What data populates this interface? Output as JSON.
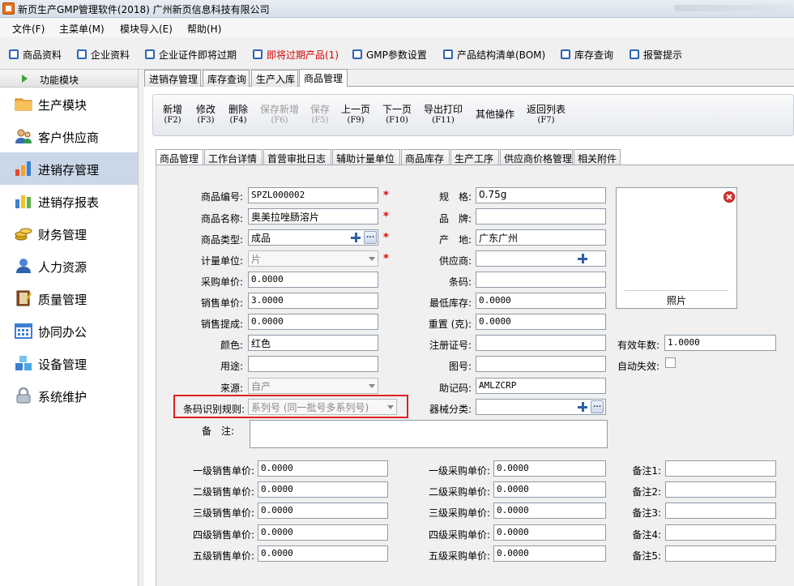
{
  "window": {
    "title": "新页生产GMP管理软件(2018) 广州新页信息科技有限公司"
  },
  "menu": [
    "文件(F)",
    "主菜单(M)",
    "模块导入(E)",
    "帮助(H)"
  ],
  "toolbar": [
    "商品资料",
    "企业资料",
    "企业证件即将过期",
    "即将过期产品(1)",
    "GMP参数设置",
    "产品结构清单(BOM)",
    "库存查询",
    "报警提示"
  ],
  "toolbar_warn_color": "#d80000",
  "sidebar": {
    "header": "功能模块",
    "items": [
      {
        "label": "生产模块",
        "icon": "folder-icon"
      },
      {
        "label": "客户供应商",
        "icon": "people-icon"
      },
      {
        "label": "进销存管理",
        "icon": "bar-chart-icon",
        "active": true
      },
      {
        "label": "进销存报表",
        "icon": "report-icon"
      },
      {
        "label": "财务管理",
        "icon": "coins-icon"
      },
      {
        "label": "人力资源",
        "icon": "person-icon"
      },
      {
        "label": "质量管理",
        "icon": "book-icon"
      },
      {
        "label": "协同办公",
        "icon": "calendar-icon"
      },
      {
        "label": "设备管理",
        "icon": "cubes-icon"
      },
      {
        "label": "系统维护",
        "icon": "lock-icon"
      }
    ]
  },
  "outer_tabs": [
    "进销存管理",
    "库存查询",
    "生产入库",
    "商品管理"
  ],
  "actions": [
    {
      "label": "新增",
      "key": "(F2)"
    },
    {
      "label": "修改",
      "key": "(F3)"
    },
    {
      "label": "删除",
      "key": "(F4)"
    },
    {
      "label": "保存新增",
      "key": "(F6)",
      "disabled": true
    },
    {
      "label": "保存",
      "key": "(F5)",
      "disabled": true
    },
    {
      "label": "上一页",
      "key": "(F9)"
    },
    {
      "label": "下一页",
      "key": "(F10)"
    },
    {
      "label": "导出打印",
      "key": "(F11)"
    },
    {
      "label": "其他操作",
      "key": ""
    },
    {
      "label": "返回列表",
      "key": "(F7)"
    }
  ],
  "inner_tabs": [
    "商品管理",
    "工作台详情",
    "首营审批日志",
    "辅助计量单位",
    "商品库存",
    "生产工序",
    "供应商价格管理",
    "相关附件"
  ],
  "form": {
    "left": [
      {
        "label": "商品编号:",
        "value": "SPZL000002",
        "required": true
      },
      {
        "label": "商品名称:",
        "value": "奥美拉唑肠溶片",
        "required": true
      },
      {
        "label": "商品类型:",
        "value": "成品",
        "required": true
      },
      {
        "label": "计量单位:",
        "value": "片",
        "required": true
      },
      {
        "label": "采购单价:",
        "value": "0.0000"
      },
      {
        "label": "销售单价:",
        "value": "3.0000"
      },
      {
        "label": "销售提成:",
        "value": "0.0000"
      },
      {
        "label": "颜色:",
        "value": "红色"
      },
      {
        "label": "用途:",
        "value": ""
      },
      {
        "label": "来源:",
        "value": "自产"
      },
      {
        "label": "条码识别规则:",
        "value": "系列号 (同一批号多系列号)"
      }
    ],
    "right": [
      {
        "label": "规　格:",
        "value": "0.75g"
      },
      {
        "label": "品　牌:",
        "value": ""
      },
      {
        "label": "产　地:",
        "value": "广东广州"
      },
      {
        "label": "供应商:",
        "value": ""
      },
      {
        "label": "条码:",
        "value": ""
      },
      {
        "label": "最低库存:",
        "value": "0.0000"
      },
      {
        "label": "重置 (克):",
        "value": "0.0000"
      },
      {
        "label": "注册证号:",
        "value": ""
      },
      {
        "label": "图号:",
        "value": ""
      },
      {
        "label": "助记码:",
        "value": "AMLZCRP"
      },
      {
        "label": "器械分类:",
        "value": ""
      }
    ],
    "photo_label": "照片",
    "validity_label": "有效年数:",
    "validity_value": "1.0000",
    "auto_expire_label": "自动失效:",
    "remark_label": "备　注:",
    "remark_value": "",
    "sales_prices": [
      {
        "label": "一级销售单价:",
        "value": "0.0000"
      },
      {
        "label": "二级销售单价:",
        "value": "0.0000"
      },
      {
        "label": "三级销售单价:",
        "value": "0.0000"
      },
      {
        "label": "四级销售单价:",
        "value": "0.0000"
      },
      {
        "label": "五级销售单价:",
        "value": "0.0000"
      }
    ],
    "purchase_prices": [
      {
        "label": "一级采购单价:",
        "value": "0.0000"
      },
      {
        "label": "二级采购单价:",
        "value": "0.0000"
      },
      {
        "label": "三级采购单价:",
        "value": "0.0000"
      },
      {
        "label": "四级采购单价:",
        "value": "0.0000"
      },
      {
        "label": "五级采购单价:",
        "value": "0.0000"
      }
    ],
    "notes": [
      {
        "label": "备注1:",
        "value": ""
      },
      {
        "label": "备注2:",
        "value": ""
      },
      {
        "label": "备注3:",
        "value": ""
      },
      {
        "label": "备注4:",
        "value": ""
      },
      {
        "label": "备注5:",
        "value": ""
      }
    ]
  }
}
